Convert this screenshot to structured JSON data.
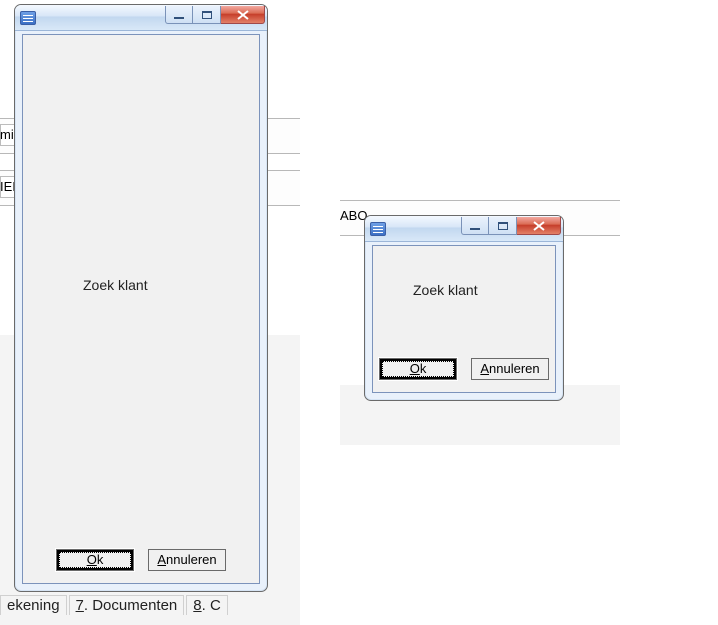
{
  "background": {
    "leftLabel1": "mi",
    "leftLabel2": "IEI",
    "rightLabel": "ABO",
    "tabs": {
      "rekening": "ekening",
      "documenten_prefix": "7",
      "documenten_label": ". Documenten",
      "next_prefix": "8",
      "next_label": ". C"
    }
  },
  "dialog1": {
    "message": "Zoek klant",
    "ok_prefix": "O",
    "ok_rest": "k",
    "cancel_prefix": "A",
    "cancel_rest": "nnuleren"
  },
  "dialog2": {
    "message": "Zoek klant",
    "ok_prefix": "O",
    "ok_rest": "k",
    "cancel_prefix": "A",
    "cancel_rest": "nnuleren"
  }
}
